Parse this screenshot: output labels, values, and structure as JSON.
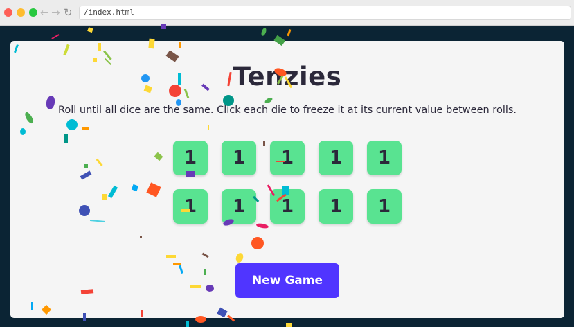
{
  "browser": {
    "url": "/index.html",
    "icons": {
      "back": "arrow-left-icon",
      "forward": "arrow-right-icon",
      "reload": "reload-icon"
    }
  },
  "app": {
    "title": "Tenzies",
    "instructions": "Roll until all dice are the same. Click each die to freeze it at its current value between rolls.",
    "dice": [
      {
        "value": "1"
      },
      {
        "value": "1"
      },
      {
        "value": "1"
      },
      {
        "value": "1"
      },
      {
        "value": "1"
      },
      {
        "value": "1"
      },
      {
        "value": "1"
      },
      {
        "value": "1"
      },
      {
        "value": "1"
      },
      {
        "value": "1"
      }
    ],
    "button_label": "New Game"
  },
  "colors": {
    "background": "#0b2434",
    "card": "#f5f5f5",
    "die": "#59e391",
    "button": "#5035ff",
    "text": "#2b283a"
  }
}
